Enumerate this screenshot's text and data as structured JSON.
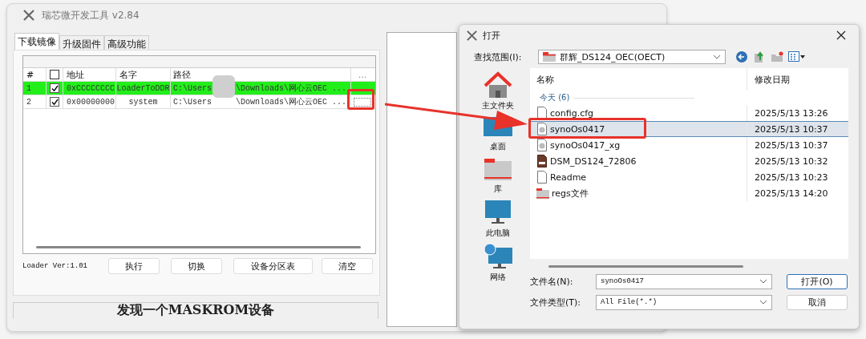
{
  "main_window": {
    "title": "瑞芯微开发工具 v2.84",
    "tabs": [
      {
        "label": "下载镜像",
        "selected": true
      },
      {
        "label": "升级固件",
        "selected": false
      },
      {
        "label": "高级功能",
        "selected": false
      }
    ],
    "table": {
      "columns": [
        {
          "kind": "text",
          "label": "#"
        },
        {
          "kind": "checkbox",
          "checked": false
        },
        {
          "kind": "text",
          "label": "地址"
        },
        {
          "kind": "text",
          "label": "名字"
        },
        {
          "kind": "text",
          "label": "路径"
        },
        {
          "kind": "text",
          "label": "..."
        }
      ],
      "rows": [
        {
          "index": "1",
          "checked": true,
          "address": "0xCCCCCCCC",
          "name": "LoaderToDDR",
          "path_start": "C:\\Users",
          "path_end": "\\Downloads\\网心云OEC ...",
          "selected": true
        },
        {
          "index": "2",
          "checked": true,
          "address": "0x00000000",
          "name": "system",
          "path_start": "C:\\Users",
          "path_end": "\\Downloads\\网心云OEC ...",
          "selected": false
        }
      ]
    },
    "loader_version": "Loader Ver:1.01",
    "buttons": [
      "执行",
      "切换",
      "设备分区表",
      "清空"
    ],
    "status": "发现一个MASKROM设备"
  },
  "open_dialog": {
    "title": "打开",
    "look_in_label": "查找范围(I):",
    "look_in_value": "群辉_DS124_OEC(OECT)",
    "places": [
      {
        "kind": "home",
        "label": "主文件夹"
      },
      {
        "kind": "desktop",
        "label": "桌面"
      },
      {
        "kind": "library",
        "label": "库"
      },
      {
        "kind": "computer",
        "label": "此电脑"
      },
      {
        "kind": "network",
        "label": "网络"
      }
    ],
    "columns": [
      "名称",
      "修改日期"
    ],
    "group": "今天 (6)",
    "files": [
      {
        "kind": "text",
        "name": "config.cfg",
        "date": "2025/5/13 13:26",
        "selected": false
      },
      {
        "kind": "disk",
        "name": "synoOs0417",
        "date": "2025/5/13 10:37",
        "selected": true
      },
      {
        "kind": "disk",
        "name": "synoOs0417_xg",
        "date": "2025/5/13 10:37",
        "selected": false
      },
      {
        "kind": "archive",
        "name": "DSM_DS124_72806",
        "date": "2025/5/13 10:32",
        "selected": false
      },
      {
        "kind": "text",
        "name": "Readme",
        "date": "2025/5/13 10:23",
        "selected": false
      },
      {
        "kind": "folder",
        "name": "regs文件",
        "date": "2025/5/13 14:20",
        "selected": false
      }
    ],
    "file_name_label": "文件名(N):",
    "file_name_value": "synoOs0417",
    "file_type_label": "文件类型(T):",
    "file_type_value": "All File(*.*)",
    "buttons": [
      "打开(O)",
      "取消"
    ]
  }
}
